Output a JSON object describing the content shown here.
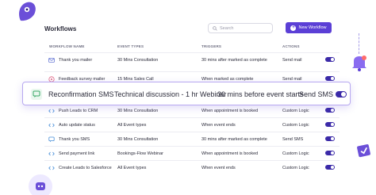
{
  "header": {
    "title": "Workflows",
    "search_placeholder": "Search",
    "new_workflow_label": "New Workflow"
  },
  "columns": {
    "name": "WORKFLOW NAME",
    "event_types": "EVENT TYPES",
    "triggers": "TRIGGERS",
    "actions": "ACTIONS"
  },
  "rows": [
    {
      "name": "Thank you mailer",
      "event": "30 Mins Consultation",
      "trigger": "30 mins after marked as complete",
      "action": "Send mail",
      "icon": "mail-icon"
    },
    {
      "name": "Feedback survey mailer",
      "event": "15 Mins Sales Call",
      "trigger": "When marked as complete",
      "action": "Send mail",
      "icon": "survey-icon"
    },
    {
      "name": "Push Leads to CRM",
      "event": "30 Mins Consultation",
      "trigger": "When appointment is booked",
      "action": "Custom Logic",
      "icon": "code-icon"
    },
    {
      "name": "Auto update status",
      "event": "All Event types",
      "trigger": "When event ends",
      "action": "Custom Logic",
      "icon": "code-icon"
    },
    {
      "name": "Thank you SMS",
      "event": "30 Mins Consultation",
      "trigger": "30 mins after marked as complete",
      "action": "Send SMS",
      "icon": "sms-icon"
    },
    {
      "name": "Send payment link",
      "event": "Bookings-Flow Webinar",
      "trigger": "When appointment is booked",
      "action": "Custom Logic",
      "icon": "code-icon"
    },
    {
      "name": "Create Leads to Salesforce",
      "event": "All Event types",
      "trigger": "When event ends",
      "action": "Custom Logic",
      "icon": "code-icon"
    }
  ],
  "highlight": {
    "name": "Reconfirmation SMS",
    "event": "Technical discussion - 1 hr Webinar",
    "trigger": "30 mins before event starts",
    "action": "Send SMS",
    "icon": "sms-icon"
  },
  "colors": {
    "accent": "#5b3fd6",
    "toggle_on": "#3b2aa8"
  }
}
